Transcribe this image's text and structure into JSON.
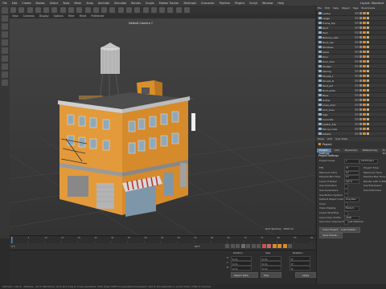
{
  "menu": [
    "File",
    "Edit",
    "Create",
    "Modes",
    "Select",
    "Tools",
    "Mesh",
    "Snap",
    "Animate",
    "Simulate",
    "Render",
    "Sculpt",
    "Motion Tracker",
    "MoGraph",
    "Character",
    "Pipeline",
    "Plugins",
    "Script",
    "Window",
    "Help"
  ],
  "layout_label": "Layout: Standard",
  "viewport": {
    "menu": [
      "View",
      "Cameras",
      "Display",
      "Options",
      "Filter",
      "Panel",
      "ProRender"
    ],
    "camera_label": "Default Camera ⁝⁝",
    "grid_label": "Grid Spacing : 1000 cm"
  },
  "object_manager": {
    "tabs": [
      "File",
      "Edit",
      "View",
      "Object",
      "Tags",
      "Bookmarks"
    ],
    "objects": [
      "Ladder",
      "Ledge",
      "Frame_top",
      "Roof",
      "Tank",
      "Balcony_rails",
      "Roof_cap",
      "Windows",
      "Glass",
      "Door",
      "Door_trim",
      "Shutter",
      "Awning",
      "Facade_L",
      "Facade_R",
      "Roof_ext",
      "Roof_parts",
      "Base",
      "Gutter",
      "Lines_misc",
      "Grid_lines",
      "Sign",
      "Concrete",
      "Ladder_top",
      "Fence_Lines",
      "Details"
    ]
  },
  "attributes": {
    "tabs": [
      "Mode",
      "Edit",
      "User Data"
    ],
    "title": "Project",
    "section_tabs": [
      "Project Settings",
      "Info",
      "Dynamics",
      "Referencing",
      "To Do"
    ],
    "section": "Project Settings",
    "rows": [
      {
        "label": "Project Scale",
        "value": "1",
        "unit": "Centimeters"
      },
      {
        "label": "FPS",
        "value": "30",
        "right_label": "Project Time"
      },
      {
        "label": "Minimum Time",
        "value": "0 F",
        "right_label": "Maximum Time"
      },
      {
        "label": "Preview Min Time",
        "value": "0 F",
        "right_label": "Preview Max Time"
      },
      {
        "label": "Level of Detail",
        "value": "100 %",
        "right_label": "Render LOD in Editor"
      },
      {
        "label": "Use Animation",
        "right_label": "Use Expression"
      },
      {
        "label": "Use Generators",
        "right_label": "Use Deformers"
      },
      {
        "label": "Use Motion System"
      },
      {
        "label": "Default Object Color",
        "value": "Gray-Blue"
      },
      {
        "label": "Color"
      },
      {
        "label": "View Clipping",
        "value": "Medium"
      },
      {
        "label": "Linear Workflow"
      },
      {
        "label": "Input Color Profile",
        "value": "sRGB"
      },
      {
        "label": "Use Color Channel for Node Material"
      }
    ],
    "buttons": [
      "Scale Project...",
      "Load Preset...",
      "Save Preset..."
    ]
  },
  "timeline": {
    "ticks": [
      "0",
      "5",
      "10",
      "15",
      "20",
      "25",
      "30",
      "35",
      "40",
      "45",
      "50",
      "55",
      "60",
      "65",
      "70",
      "75",
      "80",
      "85",
      "90"
    ],
    "current_frame": "0 F",
    "end_frame": "90 F"
  },
  "coords": {
    "headers": [
      "Position",
      "Size",
      "Rotation"
    ],
    "axes": [
      "X",
      "Y",
      "Z"
    ],
    "values": [
      "0 cm",
      "0 cm",
      "0°"
    ],
    "mode": "Object (Rel)",
    "mode2": "Size",
    "apply": "Apply"
  },
  "status": "Azimuth: 110.4°, Altitude: -15.3°  NW  Move: Click and drag to move elements. Hold down SHIFT to quantize movement / add to the selection in point mode, CTRL to remove."
}
